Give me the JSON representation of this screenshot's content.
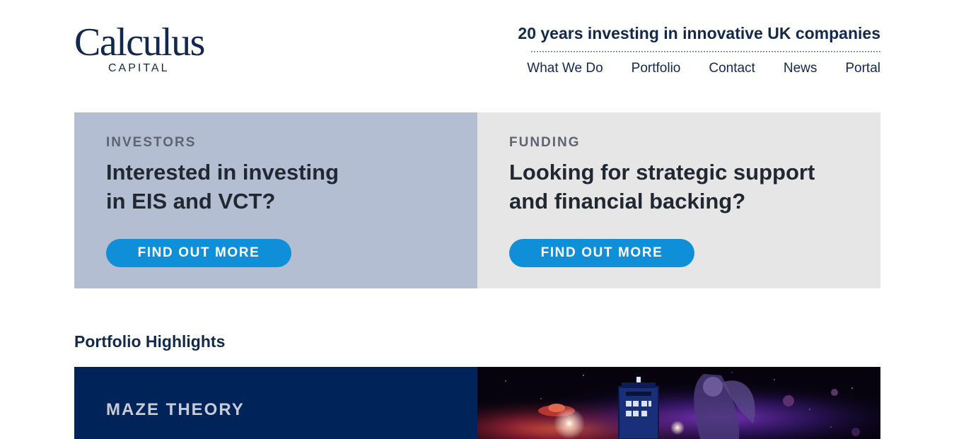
{
  "header": {
    "logo": {
      "wordmark": "Calculus",
      "subtitle": "CAPITAL"
    },
    "tagline": "20 years investing in innovative UK companies",
    "nav": [
      {
        "label": "What We Do"
      },
      {
        "label": "Portfolio"
      },
      {
        "label": "Contact"
      },
      {
        "label": "News"
      },
      {
        "label": "Portal"
      }
    ]
  },
  "panels": {
    "investors": {
      "eyebrow": "INVESTORS",
      "headline": "Interested in investing\nin EIS and VCT?",
      "cta": "FIND OUT MORE",
      "background": "#b3bed3"
    },
    "funding": {
      "eyebrow": "FUNDING",
      "headline": "Looking for strategic support\nand financial backing?",
      "cta": "FIND OUT MORE",
      "background": "#e6e6e6"
    }
  },
  "portfolio": {
    "section_title": "Portfolio Highlights",
    "highlight": {
      "name": "MAZE THEORY",
      "image": "space-scene-with-police-box-and-angel-statue"
    }
  },
  "colors": {
    "brand_navy": "#13294b",
    "cta_blue": "#0e8fd8",
    "highlight_navy": "#00245a"
  }
}
